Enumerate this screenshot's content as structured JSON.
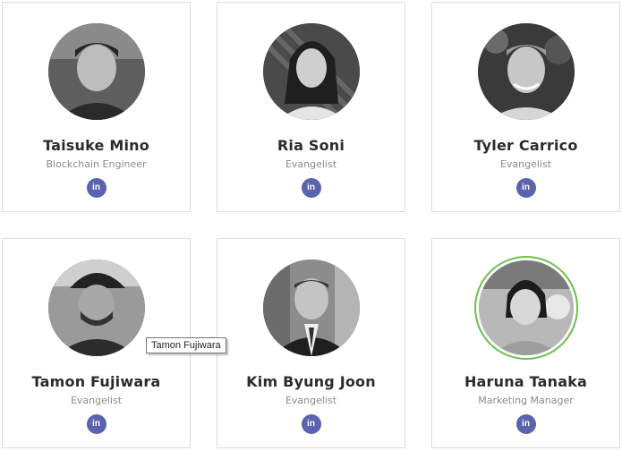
{
  "team": [
    {
      "name": "Taisuke Mino",
      "role": "Blockchain Engineer",
      "linkedin": "in"
    },
    {
      "name": "Ria Soni",
      "role": "Evangelist",
      "linkedin": "in"
    },
    {
      "name": "Tyler Carrico",
      "role": "Evangelist",
      "linkedin": "in"
    },
    {
      "name": "Tamon Fujiwara",
      "role": "Evangelist",
      "linkedin": "in"
    },
    {
      "name": "Kim Byung Joon",
      "role": "Evangelist",
      "linkedin": "in"
    },
    {
      "name": "Haruna Tanaka",
      "role": "Marketing Manager",
      "linkedin": "in"
    }
  ],
  "tooltip": {
    "text": "Tamon Fujiwara"
  },
  "colors": {
    "linkedin": "#5a63ad",
    "highlight_ring": "#6cc04a",
    "card_border": "#dcdcdc"
  }
}
